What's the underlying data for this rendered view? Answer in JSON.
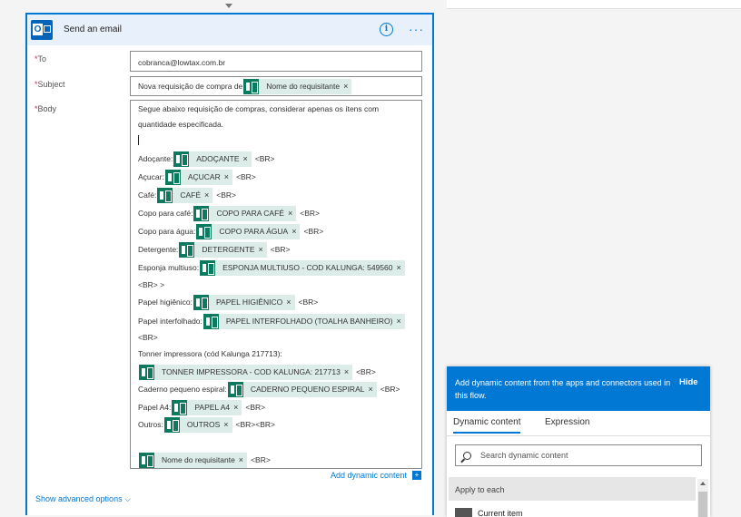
{
  "card": {
    "title": "Send an email",
    "info_icon": "info-icon",
    "more_icon": "more-icon"
  },
  "fields": {
    "to_label": "To",
    "to_value": "cobranca@lowtax.com.br",
    "subject_label": "Subject",
    "subject_text": "Nova requisição de compra de",
    "subject_token": "Nome do requisitante",
    "body_label": "Body"
  },
  "body": {
    "intro_line1": "Segue abaixo requisição de compras, considerar apenas os ítens com",
    "intro_line2": "quantidade especificada.",
    "br": "<BR>",
    "br_double": "<BR><BR>",
    "lines": [
      {
        "label": "Adoçante:",
        "token": "ADOÇANTE"
      },
      {
        "label": "Açucar:",
        "token": "AÇUCAR"
      },
      {
        "label": "Café:",
        "token": "CAFÉ"
      },
      {
        "label": "Copo para café:",
        "token": "COPO PARA CAFÉ"
      },
      {
        "label": "Copo para água:",
        "token": "COPO PARA ÁGUA"
      },
      {
        "label": "Detergente:",
        "token": "DETERGENTE"
      },
      {
        "label": "Esponja multiuso:",
        "token": "ESPONJA MULTIUSO - COD KALUNGA: 549560"
      },
      {
        "label": "Papel higiênico:",
        "token": "PAPEL HIGIÊNICO"
      },
      {
        "label": "Papel interfolhado:",
        "token": "PAPEL INTERFOLHADO (TOALHA BANHEIRO)"
      },
      {
        "label": "Tonner impressora (cód Kalunga 217713):",
        "token": "TONNER IMPRESSORA - COD KALUNGA: 217713"
      },
      {
        "label": "Caderno pequeno espiral:",
        "token": "CADERNO PEQUENO ESPIRAL"
      },
      {
        "label": "Papel A4:",
        "token": "PAPEL A4"
      },
      {
        "label": "Outros:",
        "token": "OUTROS"
      }
    ],
    "esponja_br": "<BR> >",
    "final_token": "Nome do requisitante"
  },
  "links": {
    "add_dynamic": "Add dynamic content",
    "show_advanced": "Show advanced options"
  },
  "dynamic_panel": {
    "description": "Add dynamic content from the apps and connectors used in this flow.",
    "hide": "Hide",
    "tab_dynamic": "Dynamic content",
    "tab_expression": "Expression",
    "search_placeholder": "Search dynamic content",
    "section": "Apply to each",
    "item": "Current item"
  },
  "colors": {
    "accent": "#0078d4",
    "token_bg": "#dcece8",
    "token_icon": "#0c7a5f",
    "required": "#c4314b"
  }
}
